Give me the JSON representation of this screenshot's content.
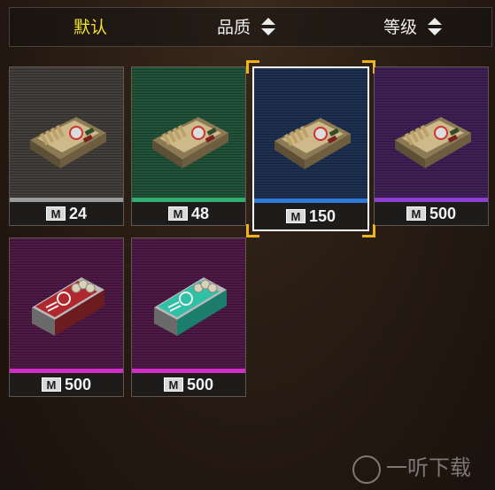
{
  "sort_bar": {
    "tabs": [
      {
        "label": "默认",
        "active": true
      },
      {
        "label": "品质",
        "active": false
      },
      {
        "label": "等级",
        "active": false
      }
    ]
  },
  "currency_label": "M",
  "items": [
    {
      "price": "24",
      "rarity_color": "#9a9a9a",
      "bg": "#3d3a37",
      "icon": "ammo-box-icon",
      "selected": false
    },
    {
      "price": "48",
      "rarity_color": "#2fae6f",
      "bg": "#1f4f36",
      "icon": "ammo-box-icon",
      "selected": false
    },
    {
      "price": "150",
      "rarity_color": "#2f7cd8",
      "bg": "#1b2d4e",
      "icon": "ammo-box-icon",
      "selected": true
    },
    {
      "price": "500",
      "rarity_color": "#8c3fd0",
      "bg": "#3b1d52",
      "icon": "ammo-box-icon",
      "selected": false
    },
    {
      "price": "500",
      "rarity_color": "#d02fc6",
      "bg": "#4a1642",
      "icon": "red-ammo-case-icon",
      "selected": false
    },
    {
      "price": "500",
      "rarity_color": "#d02fc6",
      "bg": "#4a1642",
      "icon": "teal-ammo-case-icon",
      "selected": false
    }
  ],
  "watermark": "一听下载"
}
